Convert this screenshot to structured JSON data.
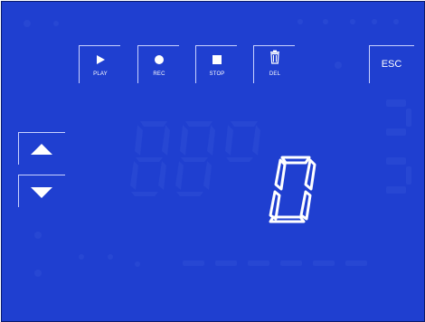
{
  "toolbar": {
    "play_label": "PLAY",
    "rec_label": "REC",
    "stop_label": "STOP",
    "del_label": "DEL",
    "esc_label": "ESC"
  },
  "display": {
    "active_digit": "0"
  },
  "colors": {
    "background": "#1f3fd0",
    "ghost_segment": "#2a4bd6",
    "foreground": "#ffffff"
  },
  "icons": {
    "play": "play-icon",
    "rec": "record-icon",
    "stop": "stop-icon",
    "del": "trash-icon",
    "up": "arrow-up-icon",
    "down": "arrow-down-icon"
  }
}
